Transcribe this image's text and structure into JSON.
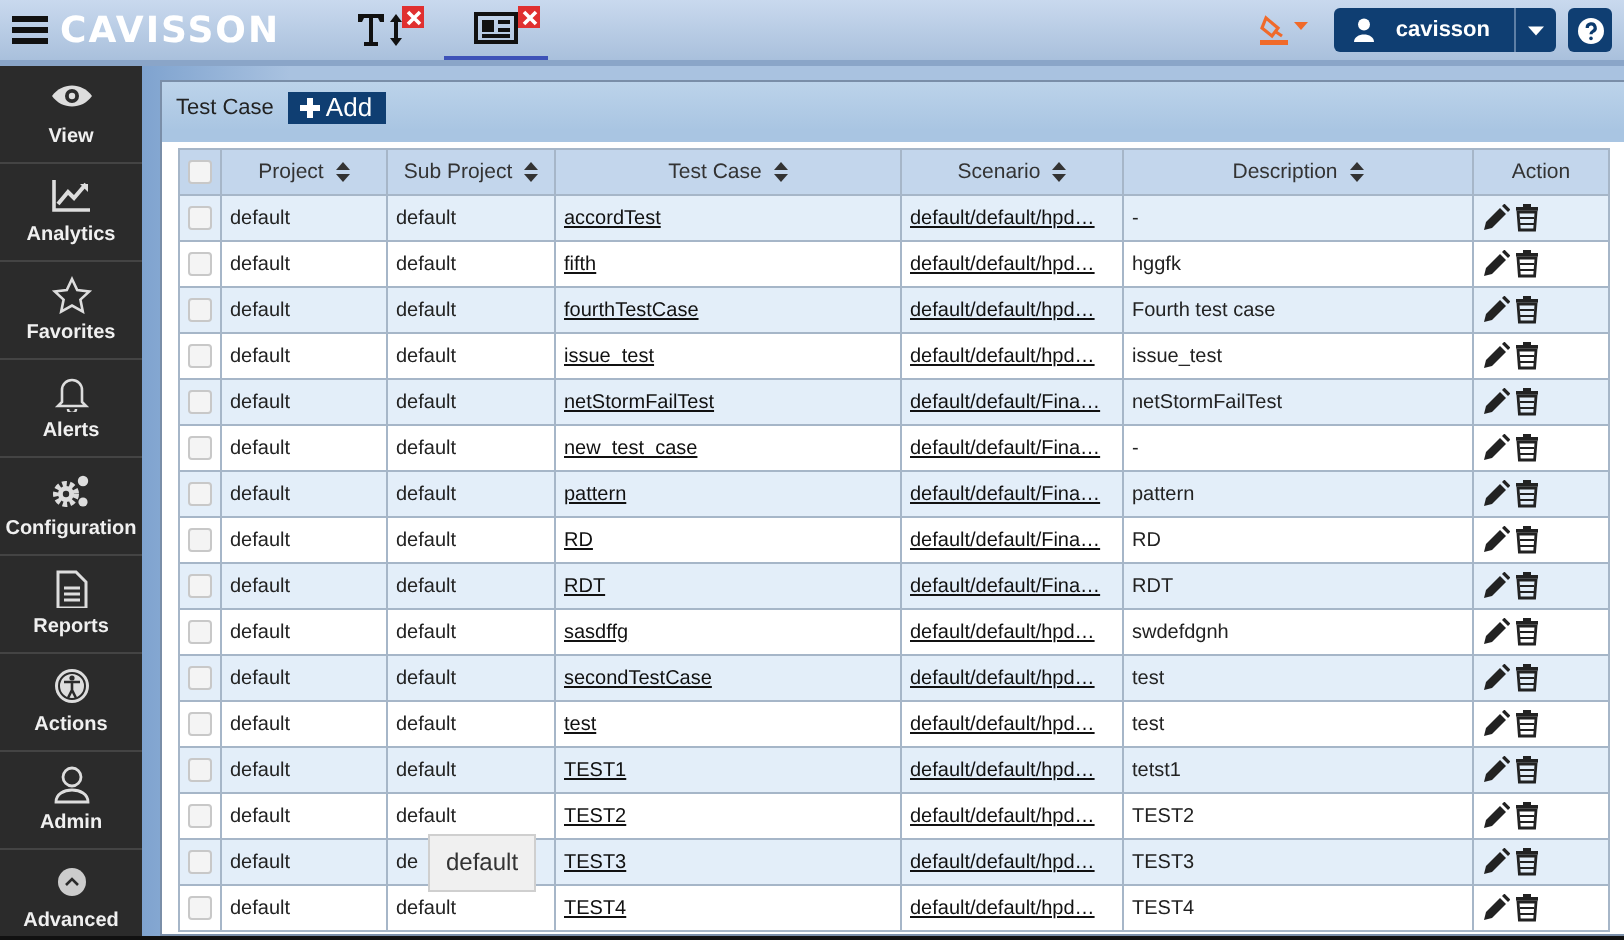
{
  "header": {
    "logo": "CAVISSON",
    "tabs": [
      {
        "kind": "text-size",
        "selected": false
      },
      {
        "kind": "news",
        "selected": true
      }
    ],
    "user": "cavisson"
  },
  "sidebar": {
    "items": [
      {
        "label": "View"
      },
      {
        "label": "Analytics"
      },
      {
        "label": "Favorites"
      },
      {
        "label": "Alerts"
      },
      {
        "label": "Configuration"
      },
      {
        "label": "Reports"
      },
      {
        "label": "Actions"
      },
      {
        "label": "Admin"
      },
      {
        "label": "Advanced"
      }
    ]
  },
  "panel": {
    "title": "Test Case",
    "add_button": "Add"
  },
  "table": {
    "all_checked": false,
    "columns": [
      "Project",
      "Sub Project",
      "Test Case",
      "Scenario",
      "Description",
      "Action"
    ],
    "rows": [
      {
        "checked": false,
        "project": "default",
        "sub_project": "default",
        "test_case": "accordTest",
        "scenario": "default/default/hpd…",
        "description": "-"
      },
      {
        "checked": false,
        "project": "default",
        "sub_project": "default",
        "test_case": "fifth",
        "scenario": "default/default/hpd…",
        "description": "hggfk"
      },
      {
        "checked": false,
        "project": "default",
        "sub_project": "default",
        "test_case": "fourthTestCase",
        "scenario": "default/default/hpd…",
        "description": "Fourth test case"
      },
      {
        "checked": false,
        "project": "default",
        "sub_project": "default",
        "test_case": "issue_test",
        "scenario": "default/default/hpd…",
        "description": "issue_test"
      },
      {
        "checked": false,
        "project": "default",
        "sub_project": "default",
        "test_case": "netStormFailTest",
        "scenario": "default/default/Fina…",
        "description": "netStormFailTest"
      },
      {
        "checked": false,
        "project": "default",
        "sub_project": "default",
        "test_case": "new_test_case",
        "scenario": "default/default/Fina…",
        "description": "-"
      },
      {
        "checked": false,
        "project": "default",
        "sub_project": "default",
        "test_case": "pattern",
        "scenario": "default/default/Fina…",
        "description": "pattern"
      },
      {
        "checked": false,
        "project": "default",
        "sub_project": "default",
        "test_case": "RD",
        "scenario": "default/default/Fina…",
        "description": "RD"
      },
      {
        "checked": false,
        "project": "default",
        "sub_project": "default",
        "test_case": "RDT",
        "scenario": "default/default/Fina…",
        "description": "RDT"
      },
      {
        "checked": false,
        "project": "default",
        "sub_project": "default",
        "test_case": "sasdffg",
        "scenario": "default/default/hpd…",
        "description": "swdefdgnh"
      },
      {
        "checked": false,
        "project": "default",
        "sub_project": "default",
        "test_case": "secondTestCase",
        "scenario": "default/default/hpd…",
        "description": "test"
      },
      {
        "checked": false,
        "project": "default",
        "sub_project": "default",
        "test_case": "test",
        "scenario": "default/default/hpd…",
        "description": "test"
      },
      {
        "checked": false,
        "project": "default",
        "sub_project": "default",
        "test_case": "TEST1",
        "scenario": "default/default/hpd…",
        "description": "tetst1"
      },
      {
        "checked": false,
        "project": "default",
        "sub_project": "default",
        "test_case": "TEST2",
        "scenario": "default/default/hpd…",
        "description": "TEST2"
      },
      {
        "checked": false,
        "project": "default",
        "sub_project": "de",
        "test_case": "TEST3",
        "scenario": "default/default/hpd…",
        "description": "TEST3"
      },
      {
        "checked": false,
        "project": "default",
        "sub_project": "default",
        "test_case": "TEST4",
        "scenario": "default/default/hpd…",
        "description": "TEST4"
      }
    ]
  },
  "tooltip": "default"
}
